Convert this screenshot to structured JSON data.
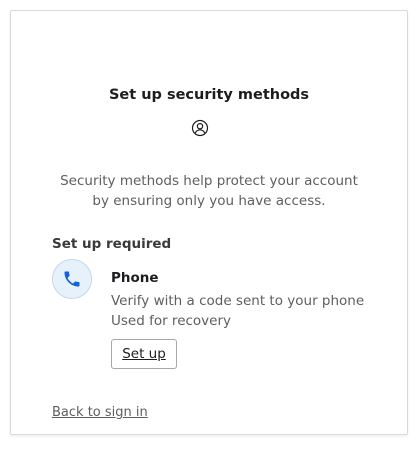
{
  "page": {
    "title": "Set up security methods",
    "header_icon": "user-circle-icon",
    "description_line1": "Security methods help protect your account",
    "description_line2": "by ensuring only you have access."
  },
  "required_section": {
    "heading": "Set up required",
    "methods": [
      {
        "icon": "phone-icon",
        "name": "Phone",
        "description": "Verify with a code sent to your phone",
        "usage": "Used for recovery",
        "button_label": "Set up"
      }
    ]
  },
  "footer": {
    "back_link": "Back to sign in"
  },
  "colors": {
    "accent": "#1662dd",
    "icon_background": "#e6f1fa",
    "text_primary": "#1d1d21",
    "text_secondary": "#5e5e5e"
  }
}
